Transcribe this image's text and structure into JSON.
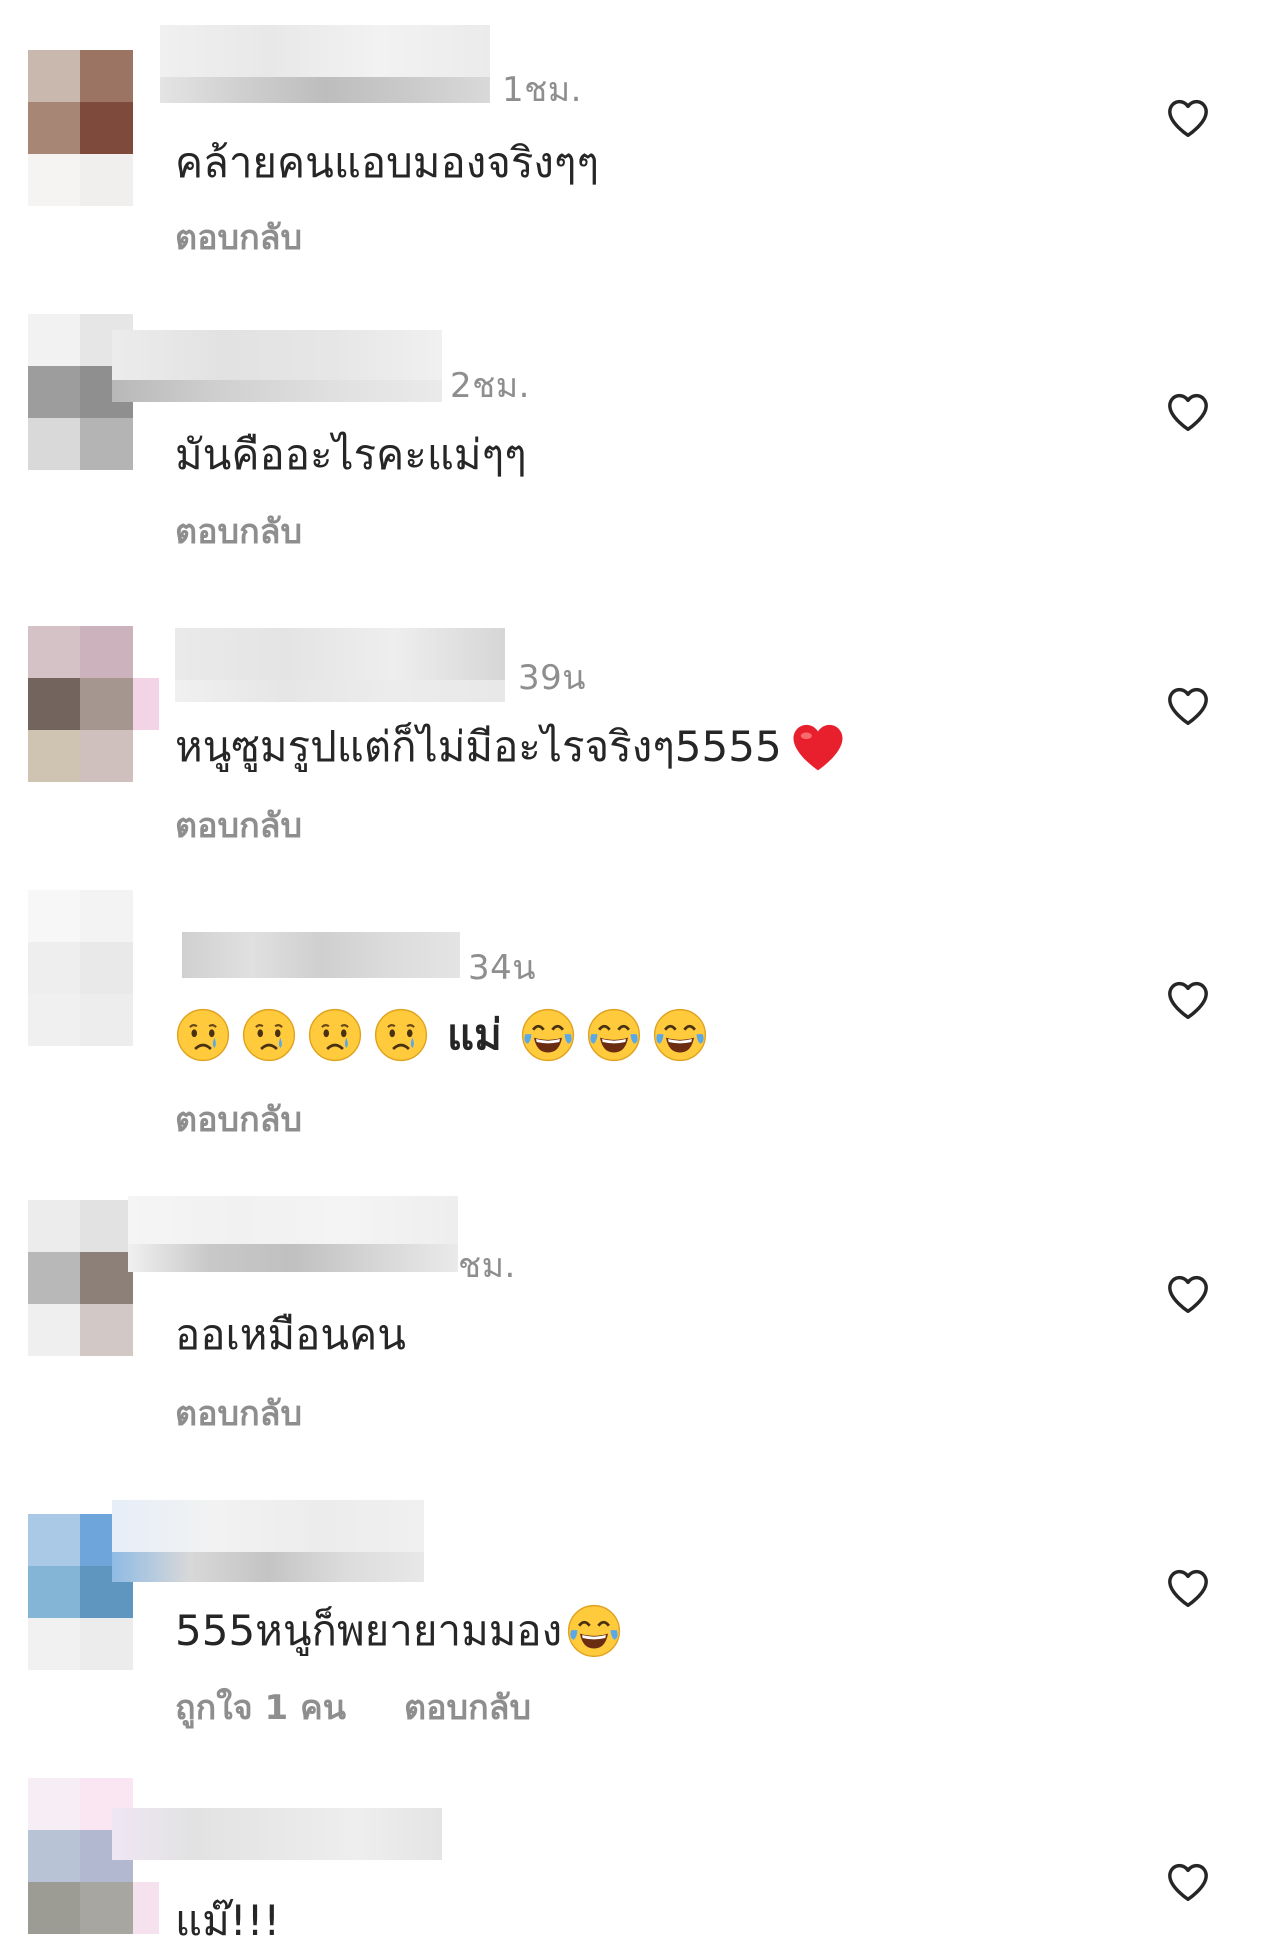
{
  "comments": [
    {
      "timestamp": "1ชม.",
      "text": "คล้ายคนแอบมองจริงๆๆ",
      "reply": "ตอบกลับ",
      "likes_label": "",
      "emojis_after": []
    },
    {
      "timestamp": "2ชม.",
      "text": "มันคืออะไรคะแม่ๆๆ",
      "reply": "ตอบกลับ",
      "likes_label": "",
      "emojis_after": []
    },
    {
      "timestamp": "39น",
      "text": "หนูซูมรูปแต่ก็ไม่มีอะไรจริงๆ5555",
      "reply": "ตอบกลับ",
      "likes_label": "",
      "emojis_after": [
        "red-heart"
      ]
    },
    {
      "timestamp": "34น",
      "text": "แม่",
      "reply": "ตอบกลับ",
      "likes_label": "",
      "emojis_before": [
        "crying-face",
        "crying-face",
        "crying-face",
        "crying-face"
      ],
      "emojis_after": [
        "tears-of-joy",
        "tears-of-joy",
        "tears-of-joy"
      ]
    },
    {
      "timestamp": "ชม.",
      "text": "ออเหมือนคน",
      "reply": "ตอบกลับ",
      "likes_label": "",
      "emojis_after": []
    },
    {
      "timestamp": "",
      "text": "555หนูก็พยายามมอง",
      "reply": "ตอบกลับ",
      "likes_label": "ถูกใจ 1 คน",
      "emojis_after": [
        "tears-of-joy"
      ]
    },
    {
      "timestamp": "",
      "text": "แม๊!!!",
      "reply": "",
      "likes_label": "",
      "emojis_after": []
    }
  ],
  "icons": {
    "like": "heart-outline-icon",
    "avatar": "pixelated-avatar",
    "username": "blurred-username"
  },
  "colors": {
    "text": "#262626",
    "muted": "#8e8e8e",
    "heart_outline": "#262626",
    "story_ring": "#f0b92e",
    "emoji_yellow": "#ffcb3d",
    "emoji_tear": "#5aa8e8",
    "red_heart": "#e8202d"
  }
}
